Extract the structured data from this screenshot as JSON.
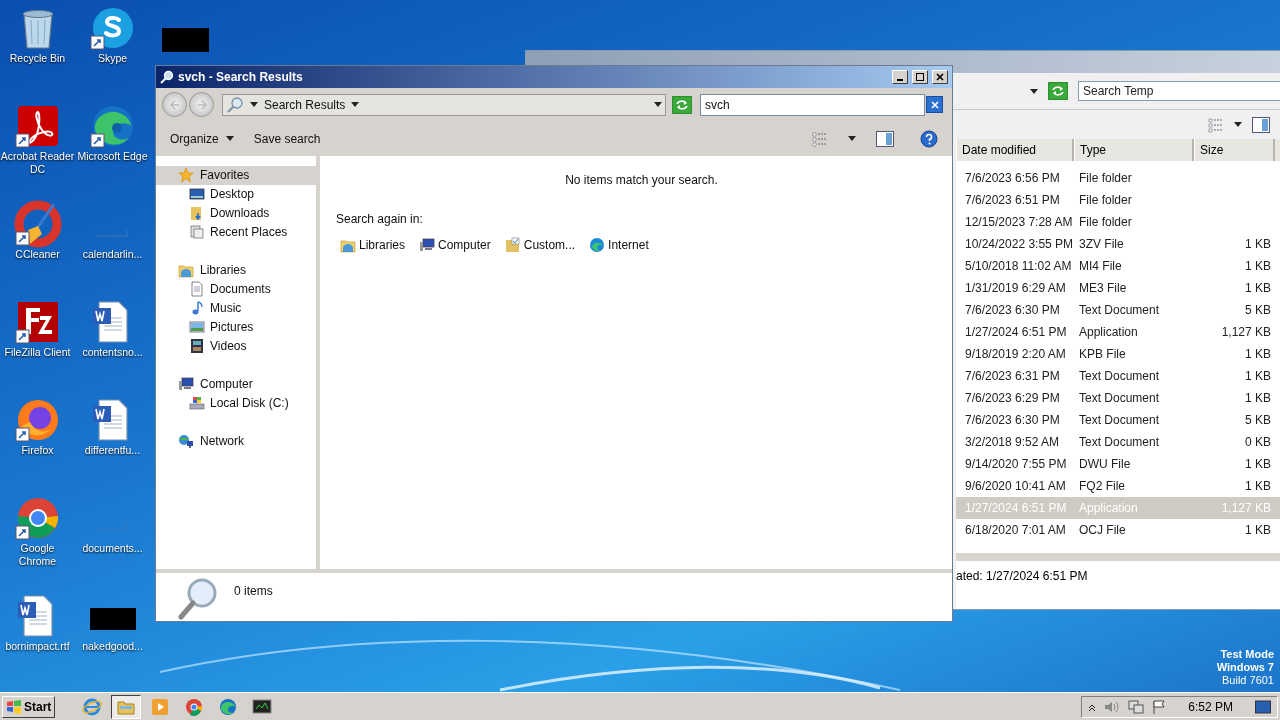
{
  "desktop_icons": [
    {
      "label": "Recycle Bin",
      "kind": "recycle",
      "shortcut": false
    },
    {
      "label": "Skype",
      "kind": "skype",
      "shortcut": true
    },
    {
      "label": "Acrobat Reader DC",
      "kind": "acrobat",
      "shortcut": true
    },
    {
      "label": "Microsoft Edge",
      "kind": "edge",
      "shortcut": true
    },
    {
      "label": "CCleaner",
      "kind": "ccleaner",
      "shortcut": true
    },
    {
      "label": "calendarlin...",
      "kind": "blank",
      "shortcut": false
    },
    {
      "label": "FileZilla Client",
      "kind": "filezilla",
      "shortcut": true
    },
    {
      "label": "contentsno...",
      "kind": "word",
      "shortcut": false
    },
    {
      "label": "Firefox",
      "kind": "firefox",
      "shortcut": true
    },
    {
      "label": "differentfu...",
      "kind": "word",
      "shortcut": false
    },
    {
      "label": "Google Chrome",
      "kind": "chrome",
      "shortcut": true
    },
    {
      "label": "documents...",
      "kind": "blank",
      "shortcut": false
    },
    {
      "label": "bornimpact.rtf",
      "kind": "word",
      "shortcut": false
    },
    {
      "label": "nakedgood...",
      "kind": "dark",
      "shortcut": false
    }
  ],
  "back_window": {
    "search": {
      "placeholder": "Search Temp"
    },
    "columns": [
      "Date modified",
      "Type",
      "Size"
    ],
    "rows": [
      {
        "date": "7/6/2023 6:56 PM",
        "type": "File folder",
        "selected": false
      },
      {
        "date": "7/6/2023 6:51 PM",
        "type": "File folder",
        "selected": false
      },
      {
        "date": "12/15/2023 7:28 AM",
        "type": "File folder",
        "selected": false
      },
      {
        "date": "10/24/2022 3:55 PM",
        "type": "3ZV File",
        "size": "1 KB",
        "selected": false
      },
      {
        "date": "5/10/2018 11:02 AM",
        "type": "MI4 File",
        "size": "1 KB",
        "selected": false
      },
      {
        "date": "1/31/2019 6:29 AM",
        "type": "ME3 File",
        "size": "1 KB",
        "selected": false
      },
      {
        "date": "7/6/2023 6:30 PM",
        "type": "Text Document",
        "size": "5 KB",
        "selected": false
      },
      {
        "date": "1/27/2024 6:51 PM",
        "type": "Application",
        "size": "1,127 KB",
        "selected": false
      },
      {
        "date": "9/18/2019 2:20 AM",
        "type": "KPB File",
        "size": "1 KB",
        "selected": false
      },
      {
        "date": "7/6/2023 6:31 PM",
        "type": "Text Document",
        "size": "1 KB",
        "selected": false
      },
      {
        "date": "7/6/2023 6:29 PM",
        "type": "Text Document",
        "size": "1 KB",
        "selected": false
      },
      {
        "date": "7/6/2023 6:30 PM",
        "type": "Text Document",
        "size": "5 KB",
        "selected": false
      },
      {
        "date": "3/2/2018 9:52 AM",
        "type": "Text Document",
        "size": "0 KB",
        "selected": false
      },
      {
        "date": "9/14/2020 7:55 PM",
        "type": "DWU File",
        "size": "1 KB",
        "selected": false
      },
      {
        "date": "9/6/2020 10:41 AM",
        "type": "FQ2 File",
        "size": "1 KB",
        "selected": false
      },
      {
        "date": "1/27/2024 6:51 PM",
        "type": "Application",
        "size": "1,127 KB",
        "selected": true
      },
      {
        "date": "6/18/2020 7:01 AM",
        "type": "OCJ File",
        "size": "1 KB",
        "selected": false
      }
    ],
    "status": "ated: 1/27/2024 6:51 PM"
  },
  "window": {
    "title": "svch - Search Results",
    "address": "Search Results",
    "search": {
      "value": "svch"
    },
    "toolbar": [
      {
        "label": "Organize",
        "dropdown": true
      },
      {
        "label": "Save search",
        "dropdown": false
      }
    ],
    "nav": [
      {
        "label": "Favorites",
        "kind": "star",
        "selected": true,
        "children": [
          {
            "label": "Desktop",
            "kind": "desktop",
            "selected": false
          },
          {
            "label": "Downloads",
            "kind": "downloads",
            "selected": false
          },
          {
            "label": "Recent Places",
            "kind": "recent",
            "selected": false
          }
        ]
      },
      {
        "label": "Libraries",
        "kind": "libraries",
        "selected": false,
        "children": [
          {
            "label": "Documents",
            "kind": "document",
            "selected": false
          },
          {
            "label": "Music",
            "kind": "music",
            "selected": false
          },
          {
            "label": "Pictures",
            "kind": "pictures",
            "selected": false
          },
          {
            "label": "Videos",
            "kind": "videos",
            "selected": false
          }
        ]
      },
      {
        "label": "Computer",
        "kind": "computer",
        "selected": false,
        "children": [
          {
            "label": "Local Disk (C:)",
            "kind": "disk",
            "selected": false
          }
        ]
      },
      {
        "label": "Network",
        "kind": "network",
        "selected": false
      }
    ],
    "message": "No items match your search.",
    "search_again": {
      "label": "Search again in:",
      "items": [
        {
          "label": "Libraries",
          "kind": "libraries"
        },
        {
          "label": "Computer",
          "kind": "computer"
        },
        {
          "label": "Custom...",
          "kind": "custom"
        },
        {
          "label": "Internet",
          "kind": "edge"
        }
      ]
    },
    "details": "0 items"
  },
  "test_mode": [
    "Test Mode",
    "Windows 7",
    "Build 7601"
  ],
  "taskbar": {
    "start": "Start",
    "apps": [
      {
        "kind": "ie",
        "selected": false
      },
      {
        "kind": "explorer",
        "selected": true
      },
      {
        "kind": "media",
        "selected": false
      },
      {
        "kind": "chrome",
        "selected": false
      },
      {
        "kind": "edge",
        "selected": false
      },
      {
        "kind": "terminal",
        "selected": false
      }
    ],
    "clock": "6:52 PM"
  }
}
